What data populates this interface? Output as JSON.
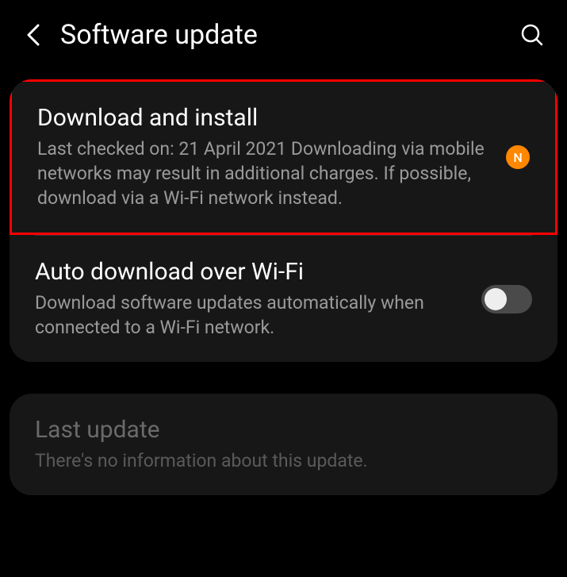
{
  "header": {
    "title": "Software update"
  },
  "items": [
    {
      "title": "Download and install",
      "subtitle": "Last checked on: 21 April 2021\nDownloading via mobile networks may result in additional charges. If possible, download via a Wi-Fi network instead.",
      "badge": "N"
    },
    {
      "title": "Auto download over Wi-Fi",
      "subtitle": "Download software updates automatically when connected to a Wi-Fi network.",
      "toggle": false
    },
    {
      "title": "Last update",
      "subtitle": "There's no information about this update."
    }
  ]
}
